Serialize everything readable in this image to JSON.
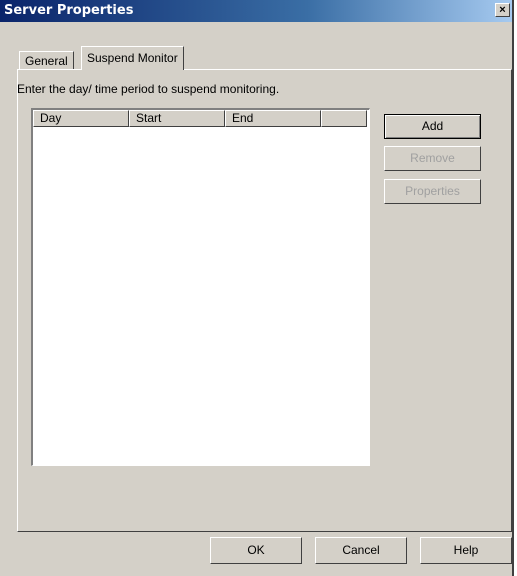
{
  "window": {
    "title": "Server Properties",
    "close_glyph": "×"
  },
  "tabs": [
    {
      "label": "General",
      "selected": false
    },
    {
      "label": "Suspend Monitor",
      "selected": true
    }
  ],
  "instruction": "Enter the day/ time period to suspend monitoring.",
  "list": {
    "columns": [
      "Day",
      "Start",
      "End",
      ""
    ],
    "rows": []
  },
  "side_buttons": {
    "add": "Add",
    "remove": "Remove",
    "properties": "Properties"
  },
  "bottom_buttons": {
    "ok": "OK",
    "cancel": "Cancel",
    "help": "Help"
  }
}
